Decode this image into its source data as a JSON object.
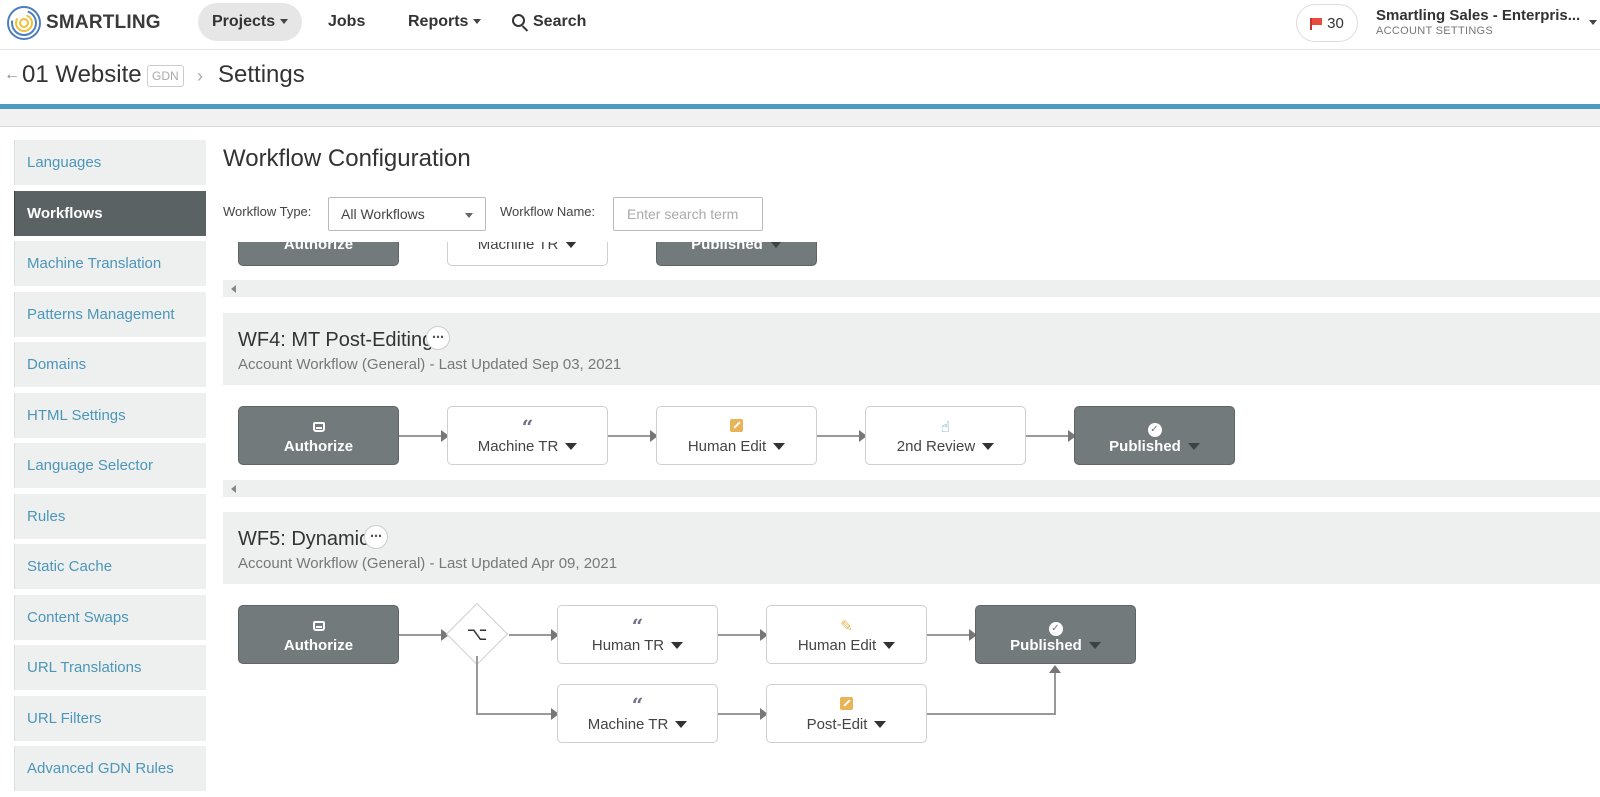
{
  "nav": {
    "logo_text": "SMARTLING",
    "projects": "Projects",
    "jobs": "Jobs",
    "reports": "Reports",
    "search": "Search",
    "issues_count": "30",
    "account_name": "Smartling Sales - Enterpris...",
    "account_sub": "ACCOUNT SETTINGS"
  },
  "breadcrumb": {
    "project": "01 Website",
    "tag": "GDN",
    "page": "Settings"
  },
  "sidebar": {
    "items": [
      {
        "label": "Languages"
      },
      {
        "label": "Workflows"
      },
      {
        "label": "Machine Translation"
      },
      {
        "label": "Patterns Management"
      },
      {
        "label": "Domains"
      },
      {
        "label": "HTML Settings"
      },
      {
        "label": "Language Selector"
      },
      {
        "label": "Rules"
      },
      {
        "label": "Static Cache"
      },
      {
        "label": "Content Swaps"
      },
      {
        "label": "URL Translations"
      },
      {
        "label": "URL Filters"
      },
      {
        "label": "Advanced GDN Rules"
      }
    ]
  },
  "main": {
    "title": "Workflow Configuration",
    "filter_type_label": "Workflow Type:",
    "filter_type_value": "All Workflows",
    "filter_name_label": "Workflow Name:",
    "filter_name_placeholder": "Enter search term"
  },
  "wf_prev": {
    "steps": [
      "Authorize",
      "Machine TR",
      "Published"
    ]
  },
  "wf4": {
    "title": "WF4: MT Post-Editing",
    "meta": "Account Workflow (General) - Last Updated Sep 03, 2021",
    "steps": [
      "Authorize",
      "Machine TR",
      "Human Edit",
      "2nd Review",
      "Published"
    ]
  },
  "wf5": {
    "title": "WF5: Dynamic",
    "meta": "Account Workflow (General) - Last Updated Apr 09, 2021",
    "steps_top": [
      "Authorize",
      "Human TR",
      "Human Edit",
      "Published"
    ],
    "steps_bottom": [
      "Machine TR",
      "Post-Edit"
    ]
  },
  "icons": {
    "menu_glyph": "⋯",
    "branch_glyph": "⌥"
  }
}
